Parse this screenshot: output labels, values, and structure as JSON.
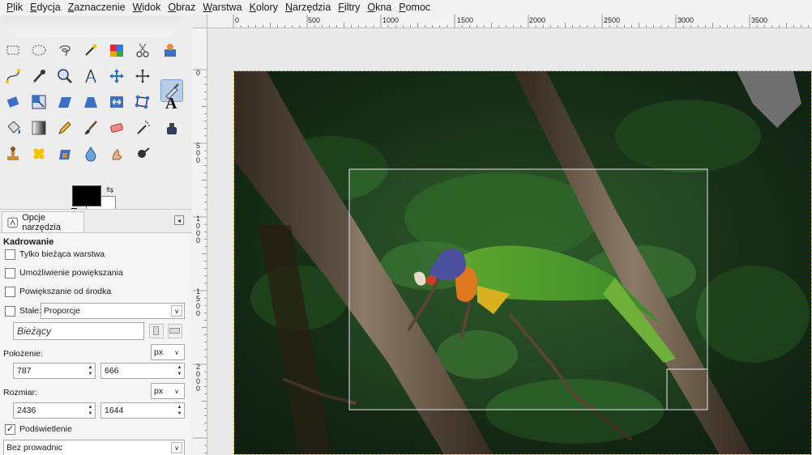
{
  "menu": [
    "Plik",
    "Edycja",
    "Zaznaczenie",
    "Widok",
    "Obraz",
    "Warstwa",
    "Kolory",
    "Narzędzia",
    "Filtry",
    "Okna",
    "Pomoc"
  ],
  "rulers": {
    "top": [
      "0",
      "500",
      "1000",
      "1500",
      "2000",
      "2500",
      "3000",
      "3500"
    ],
    "left": [
      "0",
      "5 0 0",
      "1 0 0 0",
      "1 5 0 0",
      "2 0 0 0"
    ]
  },
  "tool_options": {
    "tab_label": "Opcje narzędzia",
    "title": "Kadrowanie",
    "current_layer_only": {
      "label": "Tylko bieżąca warstwa",
      "checked": false
    },
    "allow_growing": {
      "label": "Umożliwienie powiększania",
      "checked": false
    },
    "expand_from_center": {
      "label": "Powiększanie od środka",
      "checked": false
    },
    "fixed": {
      "label": "Stałe:",
      "checked": false,
      "value": "Proporcje"
    },
    "current_value": "Bieżący",
    "position": {
      "label": "Położenie:",
      "x": "787",
      "y": "666",
      "unit": "px"
    },
    "size": {
      "label": "Rozmiar:",
      "w": "2436",
      "h": "1644",
      "unit": "px"
    },
    "highlight": {
      "label": "Podświetlenie",
      "checked": true,
      "mark": "✓"
    },
    "guides": "Bez prowadnic"
  },
  "colors": {
    "foreground": "#000000",
    "background": "#ffffff",
    "active_tool_bg": "#b6cde6",
    "selection_border": "#d4b800"
  },
  "icons": {
    "swap": "⇆",
    "menu_arrow": "◂",
    "dropdown": "∨"
  }
}
